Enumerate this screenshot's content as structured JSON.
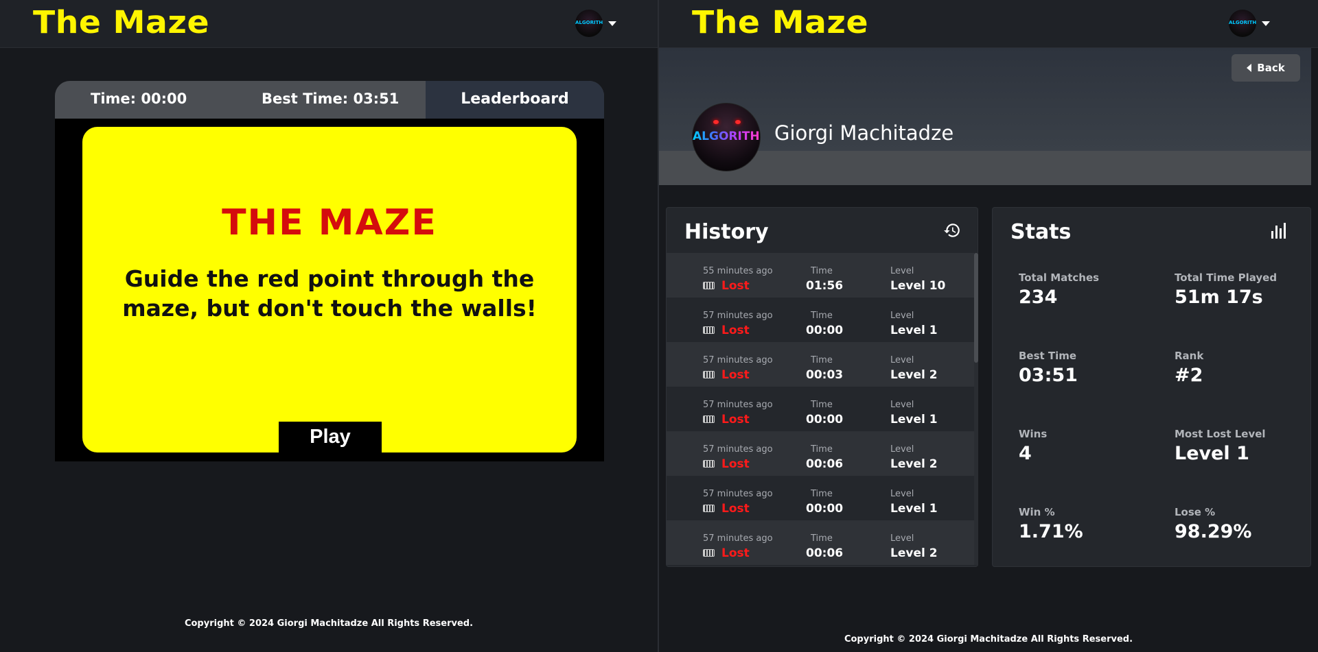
{
  "app": {
    "title": "The Maze"
  },
  "left": {
    "hud": {
      "time": "Time: 00:00",
      "best_time": "Best Time: 03:51",
      "leaderboard_tab": "Leaderboard"
    },
    "intro": {
      "title": "THE MAZE",
      "description": "Guide the red point through the maze, but don't touch the walls!",
      "play_label": "Play"
    },
    "copyright": "Copyright © 2024 Giorgi Machitadze All Rights Reserved."
  },
  "right": {
    "back_label": "Back",
    "profile": {
      "name": "Giorgi Machitadze",
      "avatar_text": "ALGORITHM"
    },
    "history": {
      "title": "History",
      "time_label": "Time",
      "level_label": "Level",
      "rows": [
        {
          "ago": "55 minutes ago",
          "result": "Lost",
          "time": "01:56",
          "level": "Level 10"
        },
        {
          "ago": "57 minutes ago",
          "result": "Lost",
          "time": "00:00",
          "level": "Level 1"
        },
        {
          "ago": "57 minutes ago",
          "result": "Lost",
          "time": "00:03",
          "level": "Level 2"
        },
        {
          "ago": "57 minutes ago",
          "result": "Lost",
          "time": "00:00",
          "level": "Level 1"
        },
        {
          "ago": "57 minutes ago",
          "result": "Lost",
          "time": "00:06",
          "level": "Level 2"
        },
        {
          "ago": "57 minutes ago",
          "result": "Lost",
          "time": "00:00",
          "level": "Level 1"
        },
        {
          "ago": "57 minutes ago",
          "result": "Lost",
          "time": "00:06",
          "level": "Level 2"
        }
      ]
    },
    "stats": {
      "title": "Stats",
      "items": [
        {
          "label": "Total Matches",
          "value": "234"
        },
        {
          "label": "Total Time Played",
          "value": "51m 17s"
        },
        {
          "label": "Best Time",
          "value": "03:51"
        },
        {
          "label": "Rank",
          "value": "#2"
        },
        {
          "label": "Wins",
          "value": "4"
        },
        {
          "label": "Most Lost Level",
          "value": "Level 1"
        },
        {
          "label": "Win %",
          "value": "1.71%"
        },
        {
          "label": "Lose %",
          "value": "98.29%"
        }
      ]
    },
    "copyright": "Copyright © 2024 Giorgi Machitadze All Rights Reserved."
  },
  "colors": {
    "brand": "#fff500",
    "maze_card": "#ffff00",
    "maze_title": "#d40d0d",
    "lost": "#ff1a1a"
  }
}
